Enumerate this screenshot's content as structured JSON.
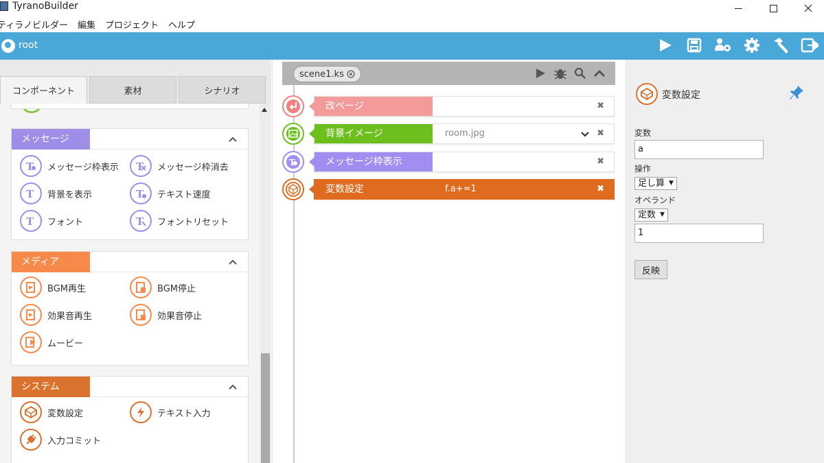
{
  "window": {
    "title": "TyranoBuilder"
  },
  "menu": [
    "ティラノビルダー",
    "編集",
    "プロジェクト",
    "ヘルプ"
  ],
  "toolbar": {
    "project_label": "root",
    "icons": [
      "play-icon",
      "save-icon",
      "users-gear-icon",
      "gear-icon",
      "hammer-icon",
      "export-icon"
    ]
  },
  "left_tabs": [
    {
      "label": "コンポーネント",
      "active": true
    },
    {
      "label": "素材",
      "active": false
    },
    {
      "label": "シナリオ",
      "active": false
    }
  ],
  "categories": [
    {
      "label": "メッセージ",
      "color": "#9f8ee8",
      "items": [
        "メッセージ枠表示",
        "メッセージ枠消去",
        "背景を表示",
        "テキスト速度",
        "フォント",
        "フォントリセット"
      ]
    },
    {
      "label": "メディア",
      "color": "#f7894a",
      "items": [
        "BGM再生",
        "BGM停止",
        "効果音再生",
        "効果音停止",
        "ムービー"
      ]
    },
    {
      "label": "システム",
      "color": "#d9722c",
      "items": [
        "変数設定",
        "テキスト入力",
        "入力コミット"
      ]
    }
  ],
  "scene": {
    "tab_label": "scene1.ks"
  },
  "timeline": [
    {
      "label": "改ページ",
      "value": "",
      "color": "#f39a9a",
      "node_color": "#f08080"
    },
    {
      "label": "背景イメージ",
      "value": "room.jpg",
      "color": "#6dbf1e",
      "node_color": "#6dbf1e"
    },
    {
      "label": "メッセージ枠表示",
      "value": "",
      "color": "#a08ff0",
      "node_color": "#a08ff0"
    },
    {
      "label": "変数設定",
      "value": "f.a+=1",
      "color": "#df6b1f",
      "node_color": "#df6b1f",
      "selected": true
    }
  ],
  "properties": {
    "title": "変数設定",
    "variable_label": "変数",
    "variable_value": "a",
    "operation_label": "操作",
    "operation_value": "足し算",
    "operand_label": "オペランド",
    "operand_type_value": "定数",
    "operand_value": "1",
    "apply_label": "反映"
  }
}
